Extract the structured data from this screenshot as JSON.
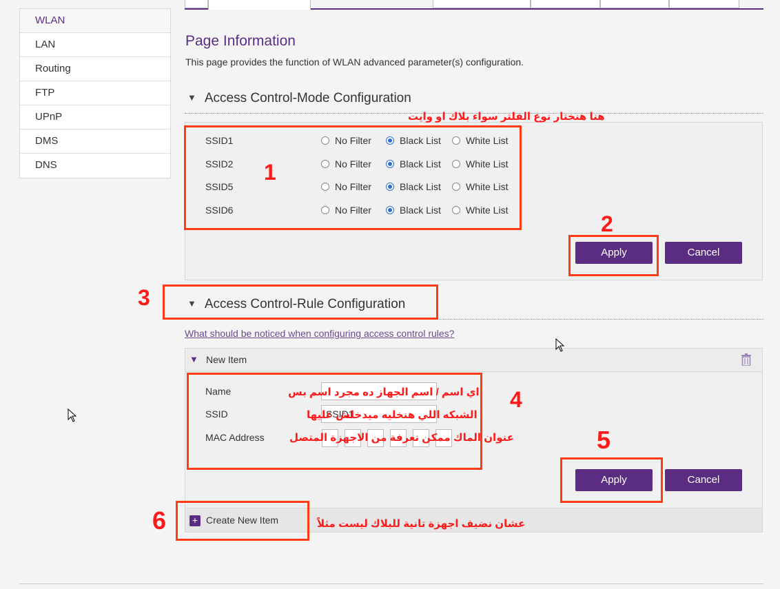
{
  "sidebar": {
    "items": [
      {
        "label": "WLAN",
        "active": true
      },
      {
        "label": "LAN"
      },
      {
        "label": "Routing"
      },
      {
        "label": "FTP"
      },
      {
        "label": "UPnP"
      },
      {
        "label": "DMS"
      },
      {
        "label": "DNS"
      }
    ]
  },
  "page": {
    "title": "Page Information",
    "description": "This page provides the function of WLAN advanced parameter(s) configuration."
  },
  "mode_section": {
    "title": "Access Control-Mode Configuration",
    "options": [
      "No Filter",
      "Black List",
      "White List"
    ],
    "rows": [
      {
        "ssid": "SSID1",
        "selected": "Black List"
      },
      {
        "ssid": "SSID2",
        "selected": "Black List"
      },
      {
        "ssid": "SSID5",
        "selected": "Black List"
      },
      {
        "ssid": "SSID6",
        "selected": "Black List"
      }
    ],
    "apply_label": "Apply",
    "cancel_label": "Cancel"
  },
  "rule_section": {
    "title": "Access Control-Rule Configuration",
    "help_link": "What should be noticed when configuring access control rules?",
    "new_item_label": "New Item",
    "fields": {
      "name_label": "Name",
      "ssid_label": "SSID",
      "ssid_value": "SSID1",
      "mac_label": "MAC Address"
    },
    "apply_label": "Apply",
    "cancel_label": "Cancel",
    "create_label": "Create New Item"
  },
  "annotations": {
    "numbers": [
      "1",
      "2",
      "3",
      "4",
      "5",
      "6"
    ],
    "note_filter": "هنا هنختار نوع الفلتر سواء بلاك او وايت",
    "note_name": "اي اسم / اسم الجهاز ده مجرد اسم بس",
    "note_ssid": "الشبكه اللي هنخليه ميدخلش عليها",
    "note_mac": "عنوان الماك ممكن نعرفة من الاجهزة المتصل",
    "note_create": "عشان نضيف اجهزة تانية للبلاك ليست مثلاً"
  },
  "colors": {
    "brand": "#5a2d82",
    "annotation": "#ff3b14",
    "radio_selected": "#2f6fd0"
  }
}
